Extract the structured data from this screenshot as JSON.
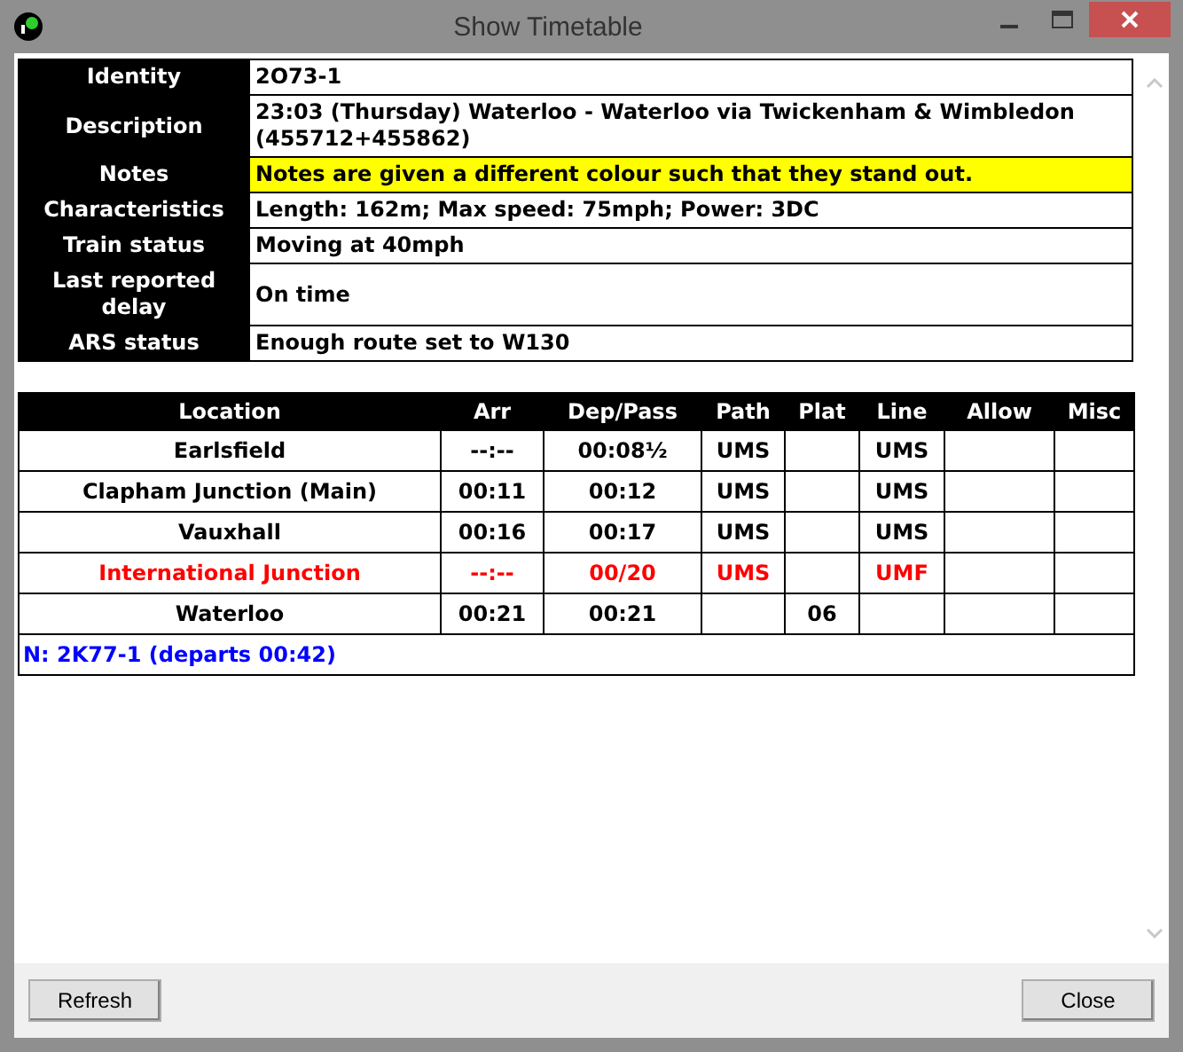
{
  "window": {
    "title": "Show Timetable"
  },
  "details": [
    {
      "label": "Identity",
      "value": "2O73-1",
      "kind": "plain"
    },
    {
      "label": "Description",
      "value": "23:03 (Thursday) Waterloo - Waterloo via Twickenham & Wimbledon (455712+455862)",
      "kind": "plain"
    },
    {
      "label": "Notes",
      "value": "Notes are given a different colour such that they stand out.",
      "kind": "note"
    },
    {
      "label": "Characteristics",
      "value": "Length: 162m; Max speed: 75mph; Power: 3DC",
      "kind": "plain"
    },
    {
      "label": "Train status",
      "value": "Moving at 40mph",
      "kind": "plain"
    },
    {
      "label": "Last reported delay",
      "value": "On time",
      "kind": "plain"
    },
    {
      "label": "ARS status",
      "value": "Enough route set to W130",
      "kind": "plain"
    }
  ],
  "timetable": {
    "columns": [
      "Location",
      "Arr",
      "Dep/Pass",
      "Path",
      "Plat",
      "Line",
      "Allow",
      "Misc"
    ],
    "rows": [
      {
        "kind": "normal",
        "cells": [
          "Earlsfield",
          "--:--",
          "00:08½",
          "UMS",
          "",
          "UMS",
          "",
          ""
        ]
      },
      {
        "kind": "normal",
        "cells": [
          "Clapham Junction (Main)",
          "00:11",
          "00:12",
          "UMS",
          "",
          "UMS",
          "",
          ""
        ]
      },
      {
        "kind": "normal",
        "cells": [
          "Vauxhall",
          "00:16",
          "00:17",
          "UMS",
          "",
          "UMS",
          "",
          ""
        ]
      },
      {
        "kind": "alert",
        "cells": [
          "International Junction",
          "--:--",
          "00/20",
          "UMS",
          "",
          "UMF",
          "",
          ""
        ]
      },
      {
        "kind": "normal",
        "cells": [
          "Waterloo",
          "00:21",
          "00:21",
          "",
          "06",
          "",
          "",
          ""
        ]
      }
    ],
    "next_working": "N: 2K77-1 (departs 00:42)"
  },
  "buttons": [
    {
      "label": "Refresh"
    },
    {
      "label": "Close"
    }
  ]
}
